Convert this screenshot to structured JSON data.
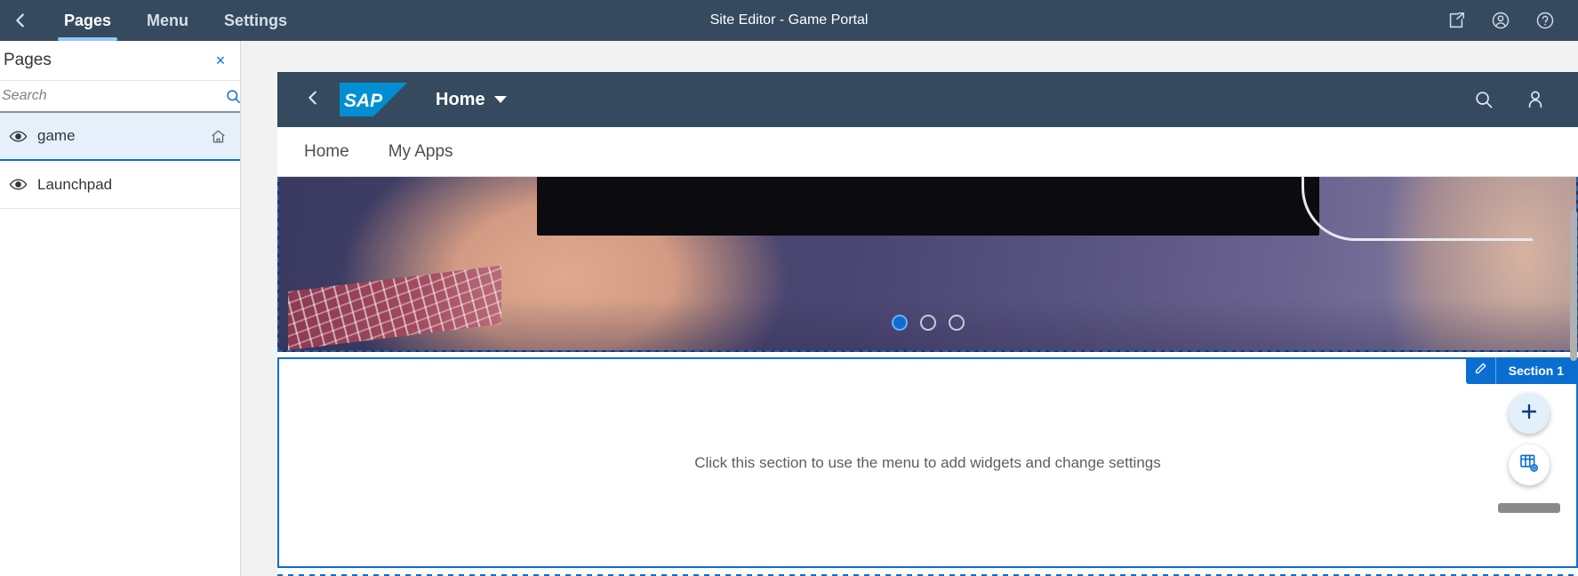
{
  "editor": {
    "back_icon": "chevron-left-icon",
    "tabs": [
      {
        "label": "Pages",
        "active": true
      },
      {
        "label": "Menu",
        "active": false
      },
      {
        "label": "Settings",
        "active": false
      }
    ],
    "title": "Site Editor - Game Portal",
    "actions": [
      {
        "name": "open-in-new-tab-icon",
        "label": "Open in New Tab"
      },
      {
        "name": "account-icon",
        "label": "Account"
      },
      {
        "name": "help-icon",
        "label": "Help"
      }
    ],
    "accent_color": "#0a6ed1",
    "bar_color": "#354a5f"
  },
  "sidebar": {
    "title": "Pages",
    "close_label": "×",
    "search": {
      "placeholder": "Search",
      "value": "",
      "icon": "search-icon"
    },
    "items": [
      {
        "label": "game",
        "selected": true,
        "visibility_icon": "eye-icon",
        "marker_icon": "home-icon"
      },
      {
        "label": "Launchpad",
        "selected": false,
        "visibility_icon": "eye-icon",
        "marker_icon": ""
      }
    ]
  },
  "preview": {
    "shell": {
      "back_icon": "chevron-left-icon",
      "logo_text": "SAP",
      "logo_color": "#008fd3",
      "home_label": "Home",
      "home_caret": "caret-down-icon",
      "right_icons": [
        {
          "name": "search-icon"
        },
        {
          "name": "user-icon"
        }
      ]
    },
    "nav_tabs": [
      {
        "label": "Home"
      },
      {
        "label": "My Apps"
      }
    ],
    "carousel": {
      "dots": [
        {
          "active": true
        },
        {
          "active": false
        },
        {
          "active": false
        }
      ]
    },
    "section": {
      "badge_label": "Section 1",
      "badge_edit_icon": "pencil-icon",
      "empty_message": "Click this section to use the menu to add widgets and change settings",
      "tools": [
        {
          "name": "add-widget-button",
          "icon": "plus-icon",
          "label": "+"
        },
        {
          "name": "section-settings-button",
          "icon": "grid-settings-icon"
        }
      ],
      "drag_handle": "drag-handle",
      "border_color": "#0a6ed1"
    }
  }
}
